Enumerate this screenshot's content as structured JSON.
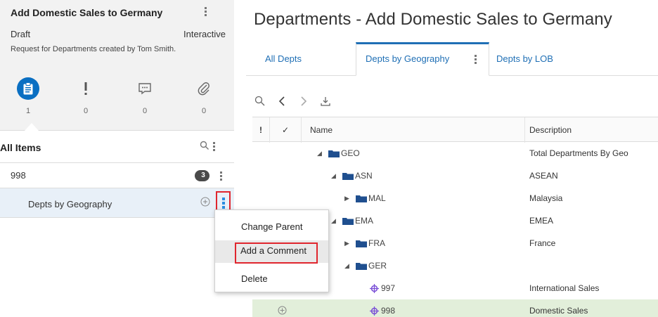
{
  "request": {
    "title": "Add Domestic Sales to Germany",
    "status": "Draft",
    "type": "Interactive",
    "description": "Request for Departments created by Tom Smith."
  },
  "request_tabs": [
    {
      "icon": "clipboard-icon",
      "count": "1"
    },
    {
      "icon": "exclamation-icon",
      "count": "0"
    },
    {
      "icon": "comment-icon",
      "count": "0"
    },
    {
      "icon": "paperclip-icon",
      "count": "0"
    }
  ],
  "items": {
    "header": "All Items",
    "rows": [
      {
        "label": "998",
        "badge": "3"
      },
      {
        "label": "Depts by Geography"
      }
    ]
  },
  "context_menu": {
    "items": [
      "Change Parent",
      "Add a Comment",
      "Delete"
    ]
  },
  "page": {
    "title": "Departments - Add Domestic Sales to Germany"
  },
  "view_tabs": [
    "All Depts",
    "Depts by Geography",
    "Depts by LOB"
  ],
  "grid": {
    "columns": [
      "!",
      "✓",
      "Name",
      "Description"
    ],
    "rows": [
      {
        "name": "GEO",
        "desc": "Total Departments By Geo"
      },
      {
        "name": "ASN",
        "desc": "ASEAN"
      },
      {
        "name": "MAL",
        "desc": "Malaysia"
      },
      {
        "name": "EMA",
        "desc": "EMEA"
      },
      {
        "name": "FRA",
        "desc": "France"
      },
      {
        "name": "GER",
        "desc": ""
      },
      {
        "name": "997",
        "desc": "International Sales"
      },
      {
        "name": "998",
        "desc": "Domestic Sales"
      }
    ]
  },
  "colors": {
    "accent": "#0a6fc2",
    "highlight_red": "#e0262e",
    "folder": "#1f4f8f",
    "node": "#7a4fd6",
    "selected_row": "#e2efda"
  }
}
